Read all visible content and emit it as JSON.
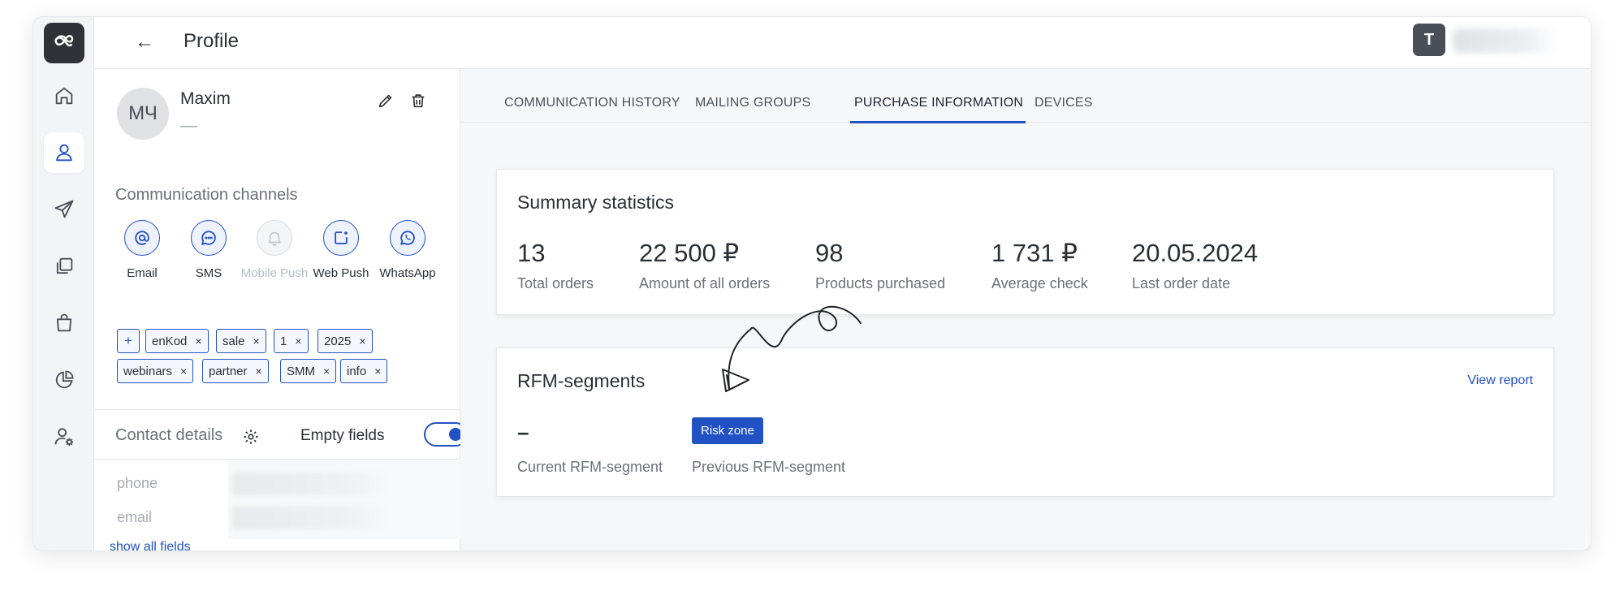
{
  "header": {
    "back_icon": "←",
    "title": "Profile",
    "user_initial": "T"
  },
  "sidebar": {
    "items": [
      {
        "name": "home",
        "icon": "home-icon"
      },
      {
        "name": "contacts",
        "icon": "user-icon",
        "active": true
      },
      {
        "name": "campaigns",
        "icon": "send-icon"
      },
      {
        "name": "templates",
        "icon": "copy-icon"
      },
      {
        "name": "shop",
        "icon": "bag-icon"
      },
      {
        "name": "analytics",
        "icon": "pie-chart-icon"
      },
      {
        "name": "user-settings",
        "icon": "user-gear-icon"
      }
    ]
  },
  "profile": {
    "initials": "МЧ",
    "name": "Maxim",
    "subtitle": "—",
    "channels_title": "Communication channels",
    "channels": [
      {
        "label": "Email",
        "icon": "at-icon",
        "enabled": true
      },
      {
        "label": "SMS",
        "icon": "chat-icon",
        "enabled": true
      },
      {
        "label": "Mobile Push",
        "icon": "bell-icon",
        "enabled": false
      },
      {
        "label": "Web Push",
        "icon": "web-push-icon",
        "enabled": true
      },
      {
        "label": "WhatsApp",
        "icon": "whatsapp-icon",
        "enabled": true
      }
    ],
    "tag_add": "+",
    "tags": [
      "enKod",
      "sale",
      "1",
      "2025",
      "webinars",
      "partner",
      "SMM",
      "info"
    ],
    "tag_remove": "×",
    "contact_details_title": "Contact details",
    "empty_fields_label": "Empty fields",
    "empty_fields_on": true,
    "fields": [
      {
        "label": "phone"
      },
      {
        "label": "email"
      }
    ],
    "show_all": "show all fields"
  },
  "tabs": [
    {
      "label": "COMMUNICATION HISTORY"
    },
    {
      "label": "MAILING GROUPS"
    },
    {
      "label": "PURCHASE INFORMATION",
      "active": true
    },
    {
      "label": "DEVICES"
    }
  ],
  "summary": {
    "title": "Summary statistics",
    "stats": [
      {
        "value": "13",
        "label": "Total orders"
      },
      {
        "value": "22 500 ₽",
        "label": "Amount of all orders"
      },
      {
        "value": "98",
        "label": "Products purchased"
      },
      {
        "value": "1 731 ₽",
        "label": "Average check"
      },
      {
        "value": "20.05.2024",
        "label": "Last order date"
      }
    ]
  },
  "rfm": {
    "title": "RFM-segments",
    "view_report": "View report",
    "current_value": "–",
    "current_label": "Current RFM-segment",
    "previous_value": "Risk zone",
    "previous_label": "Previous RFM-segment"
  },
  "colors": {
    "accent": "#2152c4",
    "logo_bg": "#2f3338",
    "text": "#2b2f36",
    "muted": "#6b717a"
  }
}
